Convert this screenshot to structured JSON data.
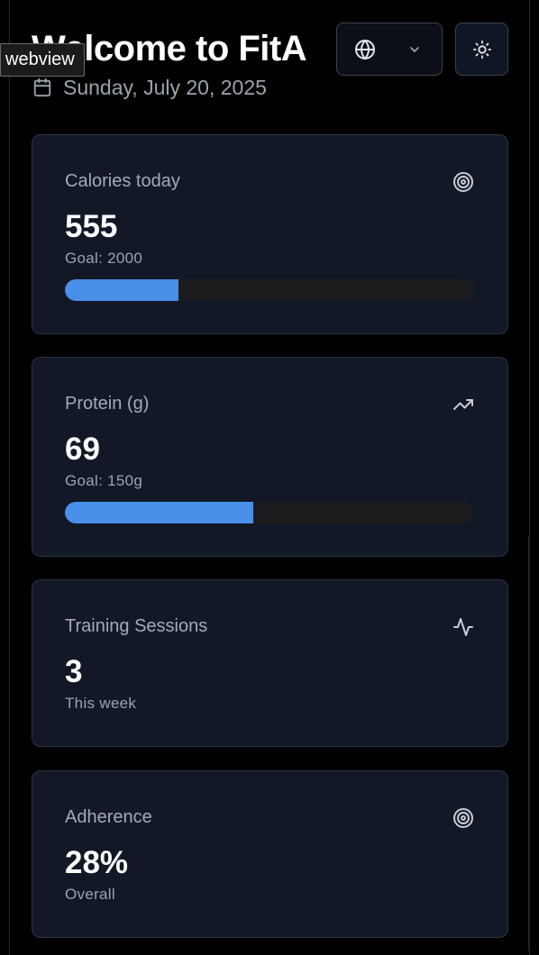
{
  "header": {
    "title": "Welcome to FitA",
    "date": "Sunday, July 20, 2025",
    "tooltip": "webview"
  },
  "controls": {
    "language_icon": "globe-icon",
    "dropdown_icon": "chevron-down-icon",
    "theme_icon": "sun-icon"
  },
  "cards": [
    {
      "label": "Calories today",
      "value": "555",
      "sub": "Goal: 2000",
      "icon": "target-icon",
      "progress": 0.2775
    },
    {
      "label": "Protein (g)",
      "value": "69",
      "sub": "Goal: 150g",
      "icon": "trending-up-icon",
      "progress": 0.46
    },
    {
      "label": "Training Sessions",
      "value": "3",
      "sub": "This week",
      "icon": "activity-icon"
    },
    {
      "label": "Adherence",
      "value": "28%",
      "sub": "Overall",
      "icon": "target-icon"
    }
  ],
  "colors": {
    "background": "#000000",
    "card": "#121826",
    "accent": "#4a8fea",
    "track": "#1c1c1e",
    "muted_text": "#9ca3af"
  }
}
